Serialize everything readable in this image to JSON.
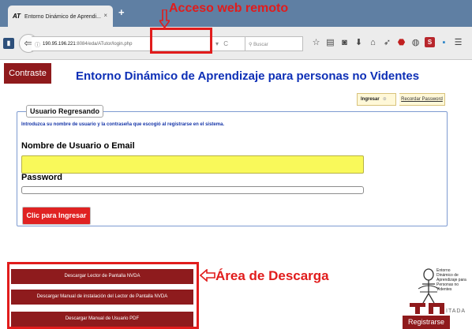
{
  "browser": {
    "tab_title": "Entorno Dinámico de Aprendi...",
    "tab_favicon": "AT",
    "tab_close": "×",
    "new_tab": "+",
    "back_glyph": "⇦",
    "url_host": "190.95.196.221",
    "url_path": ":8084/eda/ATutor/login.php",
    "url_actions": "▾ C",
    "search_placeholder": "Buscar",
    "toolbar_icons": [
      "star-icon",
      "bookmarks-icon",
      "pocket-icon",
      "download-icon",
      "home-icon",
      "send-icon",
      "adblock-icon",
      "extension-icon",
      "s-extension-icon",
      "more-icon",
      "menu-icon"
    ]
  },
  "annotations": {
    "remote_access": "Acceso web remoto",
    "download_area": "Área de Descarga",
    "color": "#e11c1c"
  },
  "header": {
    "contrast_button": "Contraste",
    "title": "Entorno Dinámico de Aprendizaje para personas no Videntes"
  },
  "auth_tabs": {
    "login": "Ingresar",
    "separator": "⊕",
    "recover": "Recordar Password"
  },
  "login_form": {
    "legend": "Usuario Regresando",
    "intro": "Introduzca su nombre de usuario y la contraseña que escogió al registrarse en el sistema.",
    "username_label": "Nombre de Usuario o Email",
    "username_value": "",
    "password_label": "Password",
    "password_value": "",
    "submit": "Clic para Ingresar"
  },
  "downloads": {
    "items": [
      "Descargar Lector de Pantalla NVDA",
      "Descargar Manual de instalación del Lector de Pantalla NVDA",
      "Descargar Manual de Usuario PDF"
    ]
  },
  "logo": {
    "line1": "Entorno",
    "line2": "Dinámico de",
    "line3": "Aprendizaje para",
    "line4": "Personas no Videntes",
    "itada": "ITADA"
  },
  "register_button": "Registrarse",
  "colors": {
    "primary": "#8f1a1c",
    "title_blue": "#0d2fb6",
    "highlight_input": "#f9f95a",
    "login_red": "#e02222"
  }
}
